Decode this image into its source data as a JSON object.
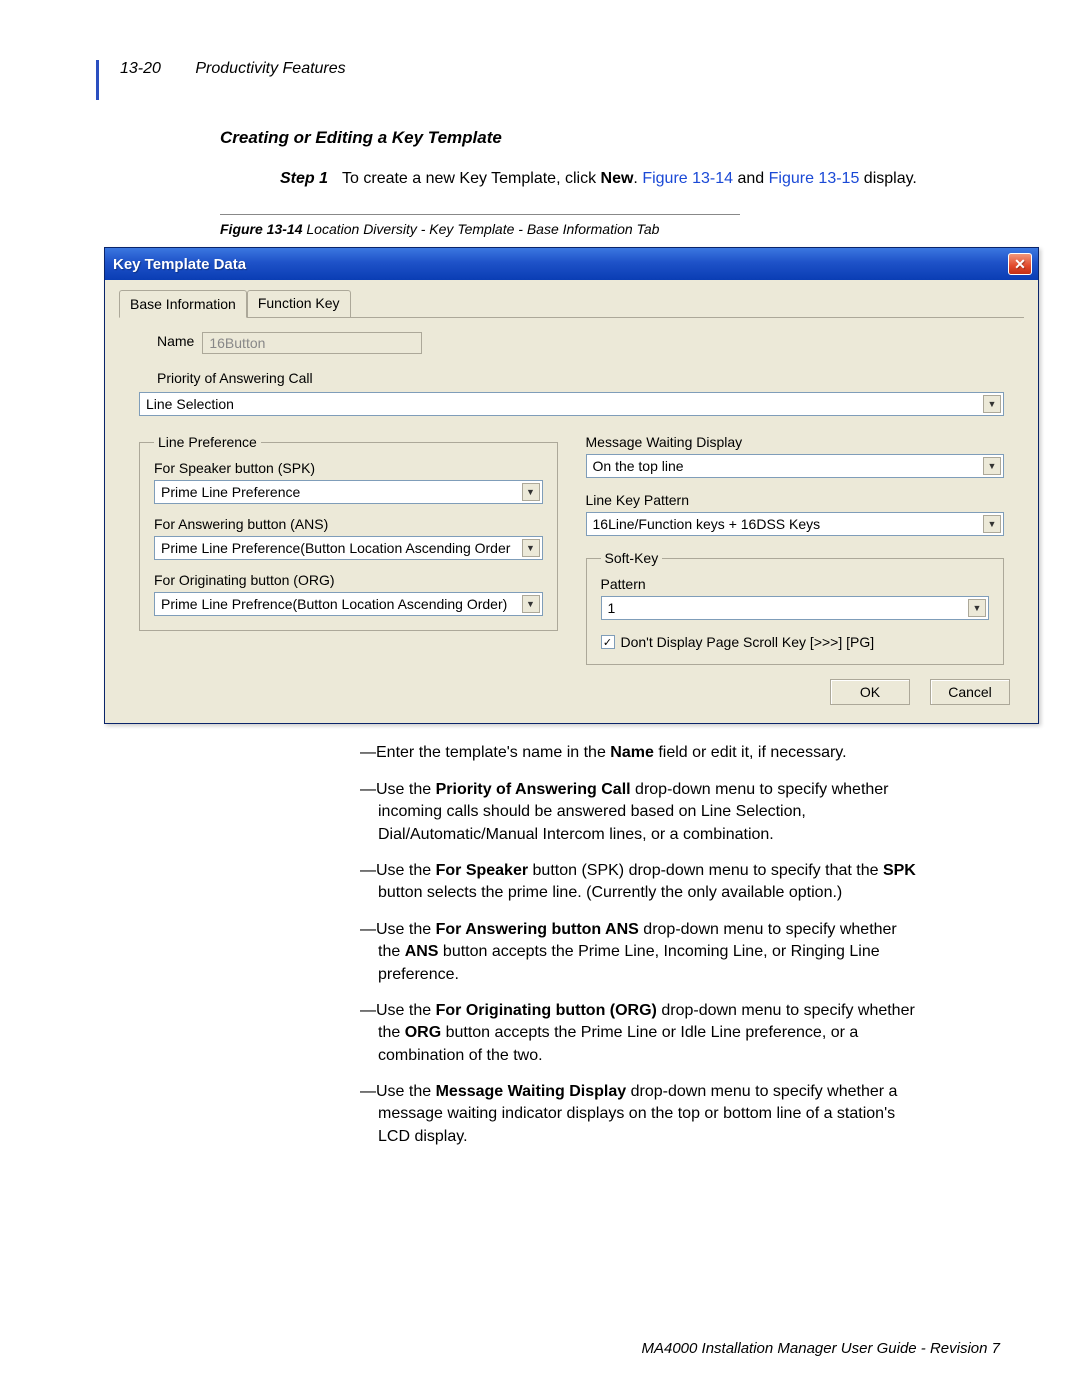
{
  "header": {
    "page_number": "13-20",
    "chapter": "Productivity Features"
  },
  "section_title": "Creating or Editing a Key Template",
  "step": {
    "label": "Step 1",
    "text_prefix": "To create a new Key Template, click ",
    "bold": "New",
    "after_bold": ". ",
    "link1": "Figure 13-14",
    "mid": " and ",
    "link2": "Figure 13-15",
    "suffix": " display."
  },
  "figure_caption": {
    "num": "Figure 13-14",
    "text": "  Location Diversity - Key Template - Base Information Tab"
  },
  "dialog": {
    "title": "Key Template Data",
    "tabs": [
      "Base Information",
      "Function Key"
    ],
    "name_label": "Name",
    "name_value": "16Button",
    "priority_label": "Priority of Answering Call",
    "priority_value": "Line Selection",
    "linepref": {
      "legend": "Line Preference",
      "spk_label": "For Speaker button (SPK)",
      "spk_value": "Prime Line Preference",
      "ans_label": "For Answering button (ANS)",
      "ans_value": "Prime Line Preference(Button Location Ascending Order",
      "org_label": "For Originating button (ORG)",
      "org_value": "Prime Line Prefrence(Button Location Ascending Order)"
    },
    "msg_label": "Message Waiting Display",
    "msg_value": "On the top line",
    "lkp_label": "Line Key Pattern",
    "lkp_value": "16Line/Function keys + 16DSS Keys",
    "softkey": {
      "legend": "Soft-Key",
      "pattern_label": "Pattern",
      "pattern_value": "1",
      "checkbox_label": "Don't Display Page Scroll Key [>>>] [PG]",
      "checked": true
    },
    "ok": "OK",
    "cancel": "Cancel"
  },
  "bullets": [
    "—Enter the template's name in the <b>Name</b> field or edit it, if necessary.",
    "—Use the <b>Priority of Answering Call</b> drop-down menu to specify whether incoming calls should be answered based on Line Selection, Dial/Automatic/Manual Intercom lines, or a combination.",
    "—Use the <b>For Speaker</b> button (SPK) drop-down menu to specify that the <b>SPK</b> button selects the prime line. (Currently the only available option.)",
    "—Use the <b>For Answering button ANS</b> drop-down menu to specify whether the <b>ANS</b> button accepts the Prime Line, Incoming Line, or Ringing Line preference.",
    "—Use the <b>For Originating button (ORG)</b> drop-down menu to specify whether the <b>ORG</b> button accepts the Prime Line or Idle Line preference, or a combination of the two.",
    "—Use the <b>Message Waiting Display</b> drop-down menu to specify whether a message waiting indicator displays on the top or bottom line of a station's LCD display."
  ],
  "footer": "MA4000 Installation Manager User Guide - Revision 7"
}
